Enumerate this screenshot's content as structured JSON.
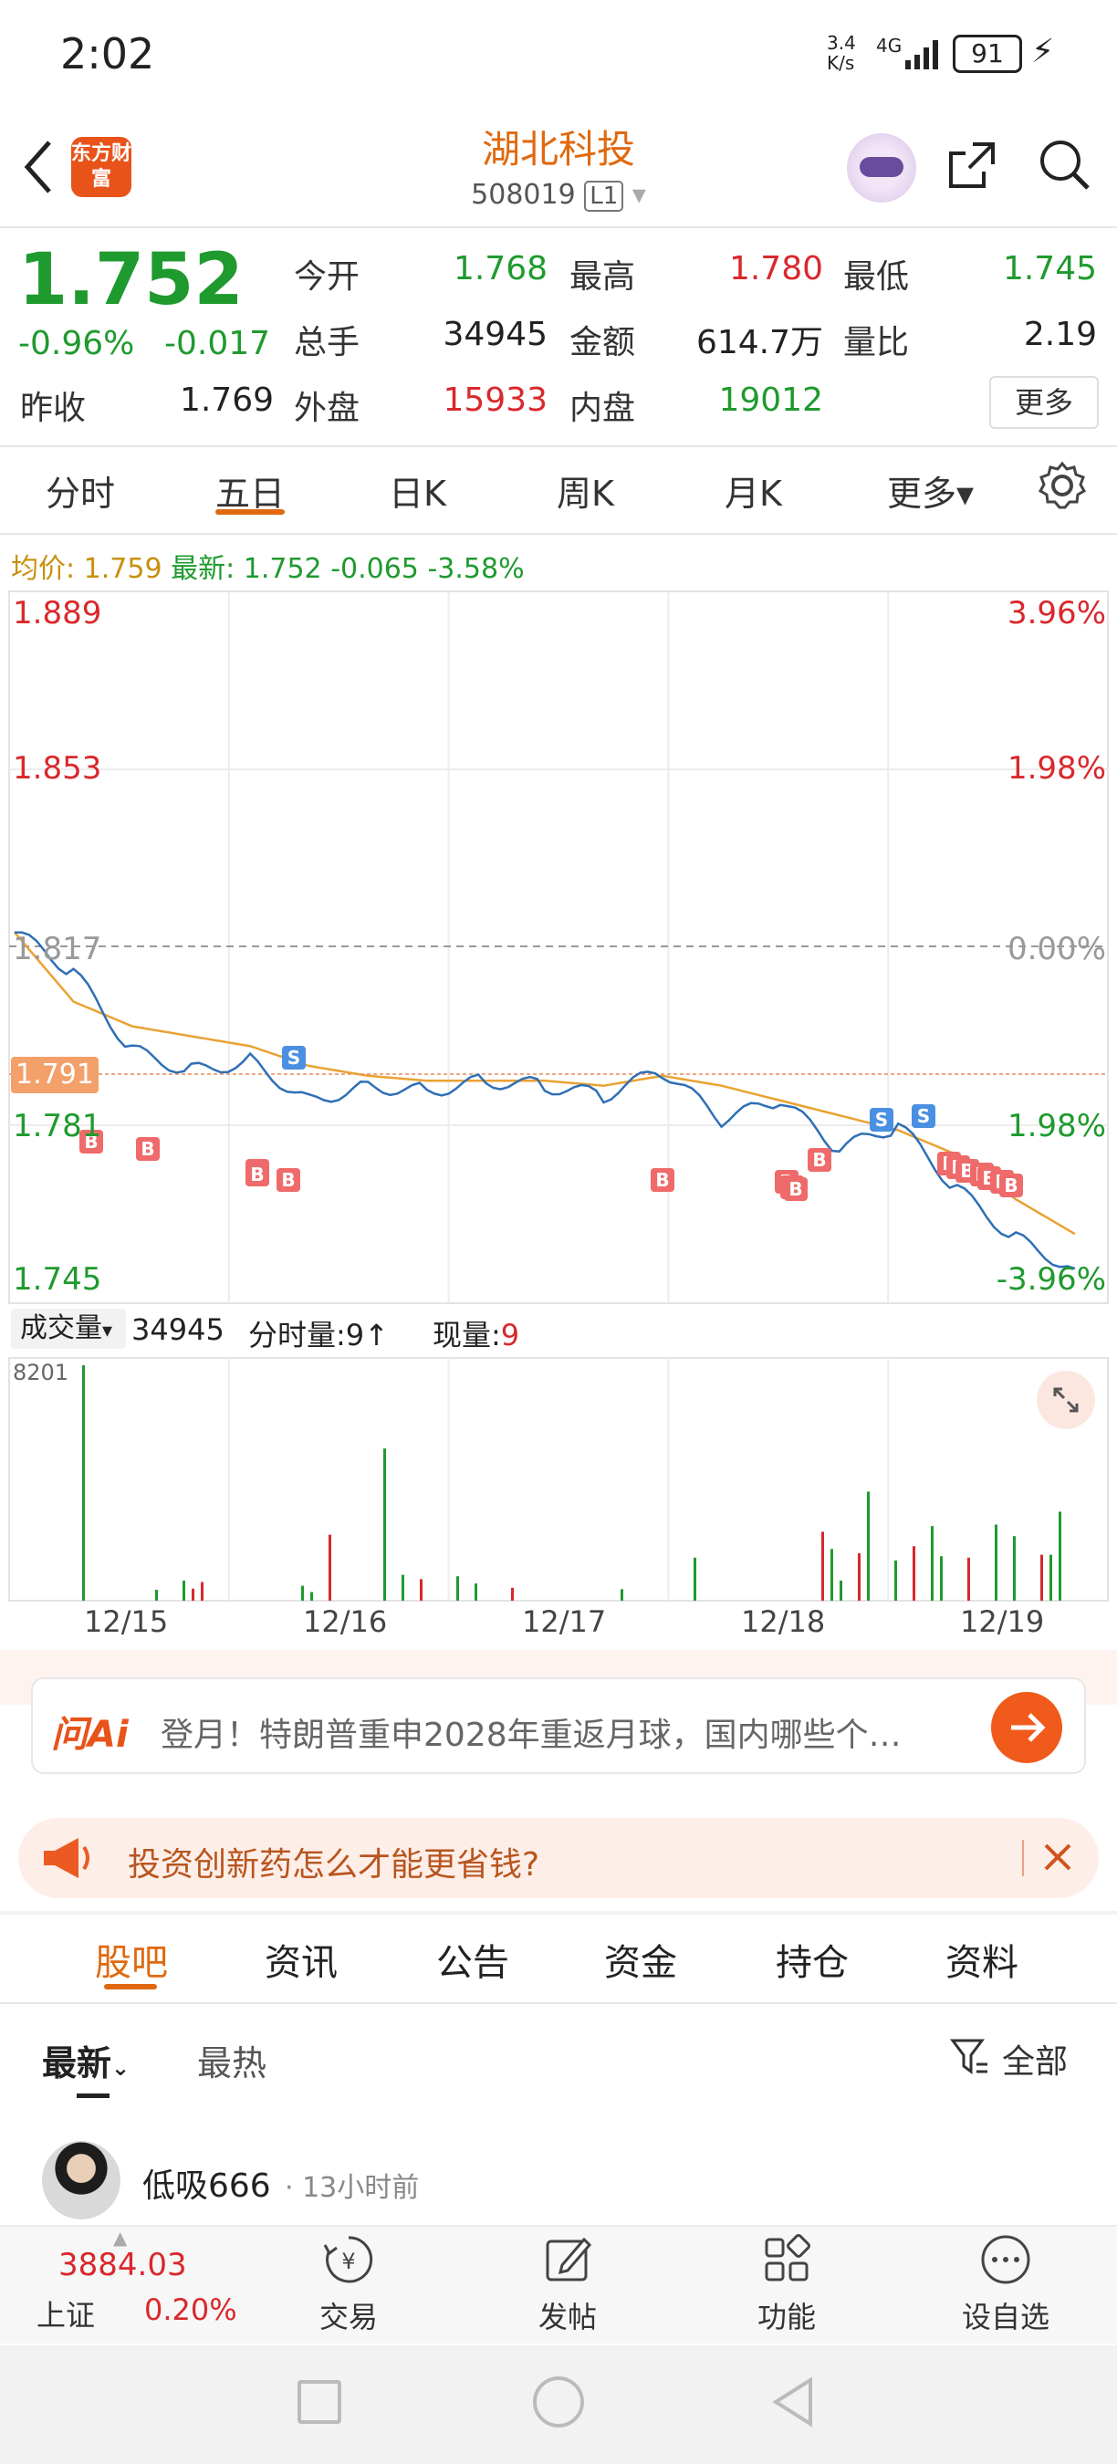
{
  "status": {
    "time": "2:02",
    "net_speed": "3.4\nK/s",
    "net_type": "4G",
    "battery": "91"
  },
  "header": {
    "app_logo": "东方财富",
    "title": "湖北科投",
    "code": "508019",
    "level": "L1"
  },
  "quote": {
    "price": "1.752",
    "change_pct": "-0.96%",
    "change": "-0.017",
    "open_label": "今开",
    "open": "1.768",
    "high_label": "最高",
    "high": "1.780",
    "low_label": "最低",
    "low": "1.745",
    "volume_label": "总手",
    "volume": "34945",
    "amount_label": "金额",
    "amount": "614.7万",
    "ratio_label": "量比",
    "ratio": "2.19",
    "prev_label": "昨收",
    "prev": "1.769",
    "outer_label": "外盘",
    "outer": "15933",
    "inner_label": "内盘",
    "inner": "19012",
    "more": "更多"
  },
  "tabs": [
    "分时",
    "五日",
    "日K",
    "周K",
    "月K",
    "更多▾"
  ],
  "active_tab": "五日",
  "avg_line": {
    "avg_label": "均价:",
    "avg": "1.759",
    "latest_label": "最新:",
    "latest": "1.752",
    "delta": "-0.065",
    "pct": "-3.58%"
  },
  "chart_data": {
    "type": "line",
    "x": [
      "12/15",
      "12/16",
      "12/17",
      "12/18",
      "12/19"
    ],
    "y_ticks_left": [
      "1.889",
      "1.853",
      "1.817",
      "1.781",
      "1.745"
    ],
    "y_ticks_right": [
      "3.96%",
      "1.98%",
      "0.00%",
      "1.98%",
      "-3.96%"
    ],
    "current_marker": "1.791",
    "ylim": [
      1.745,
      1.889
    ],
    "series": [
      {
        "name": "price",
        "values": [
          1.82,
          1.812,
          1.796,
          1.792,
          1.794,
          1.786,
          1.789,
          1.788,
          1.79,
          1.789,
          1.787,
          1.792,
          1.782,
          1.786,
          1.776,
          1.781,
          1.768,
          1.758,
          1.752
        ]
      },
      {
        "name": "avg",
        "values": [
          1.82,
          1.806,
          1.801,
          1.799,
          1.797,
          1.793,
          1.791,
          1.79,
          1.79,
          1.79,
          1.789,
          1.791,
          1.789,
          1.786,
          1.783,
          1.78,
          1.775,
          1.766,
          1.759
        ]
      }
    ],
    "marks_b": "B",
    "marks_s": "S"
  },
  "volume": {
    "label": "成交量",
    "total": "34945",
    "tick_label": "分时量:",
    "tick": "9↑",
    "now_label": "现量:",
    "now": "9",
    "max": "8201",
    "bars": [
      8201,
      420,
      380,
      700,
      650,
      520,
      300,
      2300,
      5300,
      900,
      750,
      850,
      600,
      450,
      400,
      1500,
      2400,
      700,
      1800,
      1650,
      3800,
      1400,
      1900,
      2600,
      1550,
      1500,
      2650,
      2250,
      1600,
      1600,
      3100
    ]
  },
  "ai_bar": {
    "logo": "问Ai",
    "text": "登月！特朗普重申2028年重返月球，国内哪些个…"
  },
  "notice": {
    "text": "投资创新药怎么才能更省钱?"
  },
  "sub_tabs": [
    "股吧",
    "资讯",
    "公告",
    "资金",
    "持仓",
    "资料"
  ],
  "filters": {
    "latest": "最新",
    "hot": "最热",
    "all": "全部"
  },
  "post": {
    "user": "低吸666",
    "time": "· 13小时前"
  },
  "bottom_nav": {
    "index_value": "3884.03",
    "index_name": "上证",
    "index_pct": "0.20%",
    "items": [
      "交易",
      "发帖",
      "功能",
      "设自选"
    ]
  }
}
